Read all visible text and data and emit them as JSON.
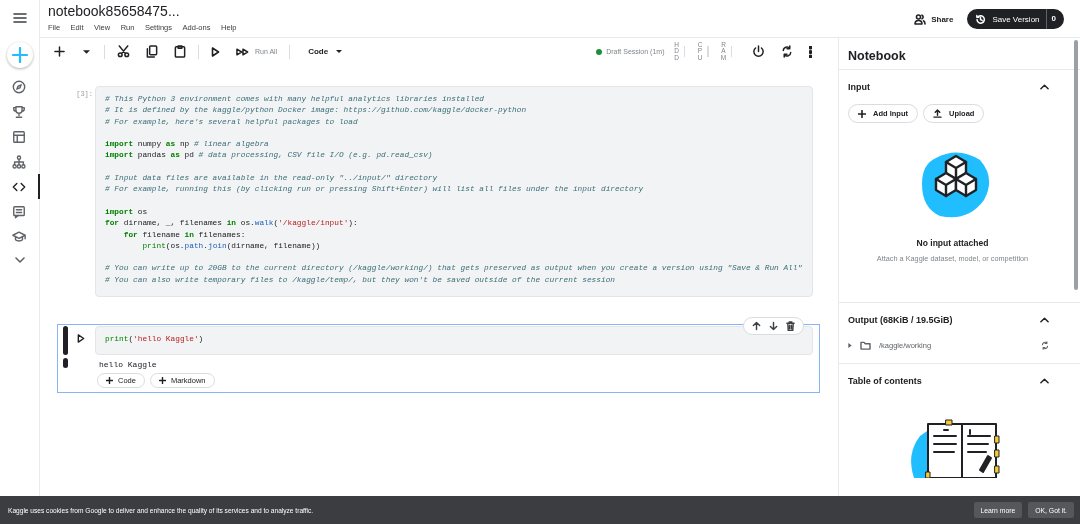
{
  "header": {
    "title": "notebook85658475...",
    "menu": [
      "File",
      "Edit",
      "View",
      "Run",
      "Settings",
      "Add-ons",
      "Help"
    ],
    "share": "Share",
    "save": {
      "label": "Save Version",
      "count": "0"
    }
  },
  "rail": [
    {
      "selected": false
    },
    {
      "selected": false
    },
    {
      "selected": false
    },
    {
      "selected": false
    },
    {
      "selected": true
    },
    {
      "selected": false
    },
    {
      "selected": false
    }
  ],
  "toolbar": {
    "run_all": "Run All",
    "cell_type": "Code",
    "session": {
      "label": "Draft Session (1m)",
      "active": true
    },
    "meters": [
      {
        "label": "HDD"
      },
      {
        "label": "CPU"
      },
      {
        "label": "RAM"
      }
    ]
  },
  "cells": [
    {
      "prompt": "[3]:",
      "selected": false,
      "lines": [
        {
          "kind": "code",
          "tokens": [
            {
              "kind": "comment",
              "t": "# This Python 3 environment comes with many helpful analytics libraries installed"
            }
          ]
        },
        {
          "kind": "code",
          "tokens": [
            {
              "kind": "comment",
              "t": "# It is defined by the kaggle/python Docker image: https://github.com/kaggle/docker-python"
            }
          ]
        },
        {
          "kind": "code",
          "tokens": [
            {
              "kind": "comment",
              "t": "# For example, here's several helpful packages to load"
            }
          ]
        },
        {
          "kind": "blank"
        },
        {
          "kind": "code",
          "tokens": [
            {
              "kind": "keyword",
              "t": "import"
            },
            {
              "kind": "plain",
              "t": " numpy "
            },
            {
              "kind": "keyword",
              "t": "as"
            },
            {
              "kind": "plain",
              "t": " np "
            },
            {
              "kind": "comment",
              "t": "# linear algebra"
            }
          ]
        },
        {
          "kind": "code",
          "tokens": [
            {
              "kind": "keyword",
              "t": "import"
            },
            {
              "kind": "plain",
              "t": " pandas "
            },
            {
              "kind": "keyword",
              "t": "as"
            },
            {
              "kind": "plain",
              "t": " pd "
            },
            {
              "kind": "comment",
              "t": "# data processing, CSV file I/O (e.g. pd.read_csv)"
            }
          ]
        },
        {
          "kind": "blank"
        },
        {
          "kind": "code",
          "tokens": [
            {
              "kind": "comment",
              "t": "# Input data files are available in the read-only \"../input/\" directory"
            }
          ]
        },
        {
          "kind": "code",
          "tokens": [
            {
              "kind": "comment",
              "t": "# For example, running this (by clicking run or pressing Shift+Enter) will list all files under the input directory"
            }
          ]
        },
        {
          "kind": "blank"
        },
        {
          "kind": "code",
          "tokens": [
            {
              "kind": "keyword",
              "t": "import"
            },
            {
              "kind": "plain",
              "t": " os"
            }
          ]
        },
        {
          "kind": "code",
          "tokens": [
            {
              "kind": "keyword",
              "t": "for"
            },
            {
              "kind": "plain",
              "t": " dirname, _, filenames "
            },
            {
              "kind": "keyword",
              "t": "in"
            },
            {
              "kind": "plain",
              "t": " os."
            },
            {
              "kind": "attribute",
              "t": "walk"
            },
            {
              "kind": "plain",
              "t": "("
            },
            {
              "kind": "string",
              "t": "'/kaggle/input'"
            },
            {
              "kind": "plain",
              "t": "):"
            }
          ]
        },
        {
          "kind": "code",
          "tokens": [
            {
              "kind": "keyword",
              "t": "    for"
            },
            {
              "kind": "plain",
              "t": " filename "
            },
            {
              "kind": "keyword",
              "t": "in"
            },
            {
              "kind": "plain",
              "t": " filenames:"
            }
          ]
        },
        {
          "kind": "code",
          "tokens": [
            {
              "kind": "builtin",
              "t": "        print"
            },
            {
              "kind": "plain",
              "t": "(os."
            },
            {
              "kind": "attribute",
              "t": "path"
            },
            {
              "kind": "plain",
              "t": "."
            },
            {
              "kind": "attribute",
              "t": "join"
            },
            {
              "kind": "plain",
              "t": "(dirname, filename))"
            }
          ]
        },
        {
          "kind": "blank"
        },
        {
          "kind": "code",
          "tokens": [
            {
              "kind": "comment",
              "t": "# You can write up to 20GB to the current directory (/kaggle/working/) that gets preserved as output when you create a version using \"Save & Run All\""
            }
          ]
        },
        {
          "kind": "code",
          "tokens": [
            {
              "kind": "comment",
              "t": "# You can also write temporary files to /kaggle/temp/, but they won't be saved outside of the current session"
            }
          ]
        }
      ]
    },
    {
      "selected": true,
      "lines": [
        {
          "kind": "code",
          "tokens": [
            {
              "kind": "builtin",
              "t": "print"
            },
            {
              "kind": "plain",
              "t": "("
            },
            {
              "kind": "string",
              "t": "'hello Kaggle'"
            },
            {
              "kind": "plain",
              "t": ")"
            }
          ]
        }
      ],
      "output": "hello Kaggle",
      "add_buttons": [
        "Code",
        "Markdown"
      ]
    }
  ],
  "panel": {
    "title": "Notebook",
    "sections": [
      {
        "kind": "input",
        "title": "Input",
        "expanded": true,
        "buttons": [
          "Add Input",
          "Upload"
        ],
        "empty_title": "No input attached",
        "empty_text": "Attach a Kaggle dataset, model, or competition"
      },
      {
        "kind": "output",
        "title": "Output (68KiB / 19.5GiB)",
        "expanded": true,
        "folder": "/kaggle/working"
      },
      {
        "kind": "toc",
        "title": "Table of contents",
        "expanded": true
      }
    ]
  },
  "cookie_bar": {
    "text": "Kaggle uses cookies from Google to deliver and enhance the quality of its services and to analyze traffic.",
    "buttons": [
      "Learn more",
      "OK, Got it."
    ]
  }
}
